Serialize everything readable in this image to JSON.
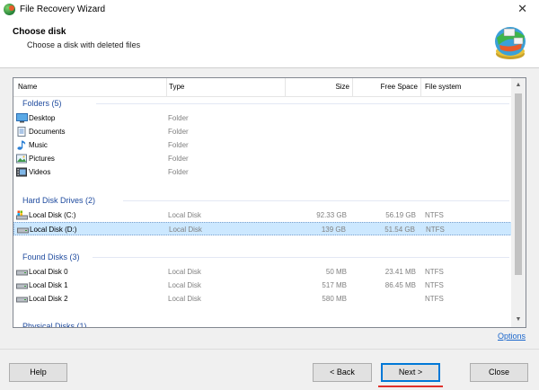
{
  "window": {
    "title": "File Recovery Wizard",
    "close_glyph": "✕"
  },
  "header": {
    "title": "Choose disk",
    "subtitle": "Choose a disk with deleted files"
  },
  "columns": {
    "name": "Name",
    "type": "Type",
    "size": "Size",
    "free": "Free Space",
    "fs": "File system"
  },
  "groups": {
    "folders": "Folders (5)",
    "hard_disks": "Hard Disk Drives (2)",
    "found": "Found Disks (3)",
    "physical": "Physical Disks (1)"
  },
  "folders": [
    {
      "name": "Desktop",
      "type": "Folder",
      "icon": "desktop-icon"
    },
    {
      "name": "Documents",
      "type": "Folder",
      "icon": "documents-icon"
    },
    {
      "name": "Music",
      "type": "Folder",
      "icon": "music-icon"
    },
    {
      "name": "Pictures",
      "type": "Folder",
      "icon": "pictures-icon"
    },
    {
      "name": "Videos",
      "type": "Folder",
      "icon": "videos-icon"
    }
  ],
  "hard_disks": [
    {
      "name": "Local Disk (C:)",
      "type": "Local Disk",
      "size": "92.33 GB",
      "free": "56.19 GB",
      "fs": "NTFS",
      "icon": "system-drive-icon"
    },
    {
      "name": "Local Disk (D:)",
      "type": "Local Disk",
      "size": "139 GB",
      "free": "51.54 GB",
      "fs": "NTFS",
      "icon": "drive-icon",
      "selected": true
    }
  ],
  "found": [
    {
      "name": "Local Disk 0",
      "type": "Local Disk",
      "size": "50 MB",
      "free": "23.41 MB",
      "fs": "NTFS",
      "icon": "drive-icon"
    },
    {
      "name": "Local Disk 1",
      "type": "Local Disk",
      "size": "517 MB",
      "free": "86.45 MB",
      "fs": "NTFS",
      "icon": "drive-icon"
    },
    {
      "name": "Local Disk 2",
      "type": "Local Disk",
      "size": "580 MB",
      "free": "",
      "fs": "NTFS",
      "icon": "drive-icon"
    }
  ],
  "options_link": "Options",
  "buttons": {
    "help": "Help",
    "back": "< Back",
    "next": "Next >",
    "close": "Close"
  },
  "colors": {
    "accent": "#0078d7",
    "group_text": "#1e4a9e",
    "selection": "#cce8ff",
    "highlight": "#e0312c"
  }
}
